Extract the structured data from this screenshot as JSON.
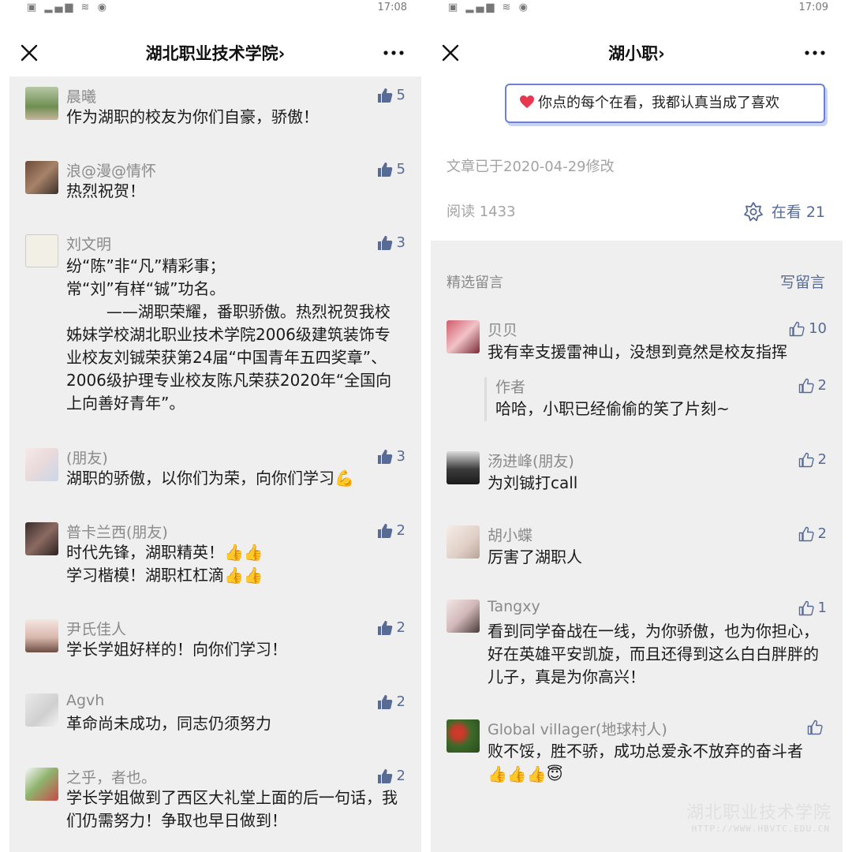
{
  "status_bar": {
    "left": {
      "time": "17:08",
      "icons": "▣ ▂▄▆ ≋ ◉"
    },
    "right": {
      "time": "17:09",
      "icons": "▣ ▂▄▆ ≋ ◉"
    }
  },
  "left": {
    "nav": {
      "title": "湖北职业技术学院",
      "chevron": "›"
    },
    "comments": [
      {
        "name": "晨曦",
        "likes": "5",
        "text": "作为湖职的校友为你们自豪，骄傲！"
      },
      {
        "name": "浪@漫@情怀",
        "likes": "5",
        "text": "热烈祝贺！"
      },
      {
        "name": "刘文明",
        "likes": "3",
        "text": "纷“陈”非“凡”精彩事；\n常“刘”有样“铖”功名。\n        ——湖职荣耀，番职骄傲。热烈祝贺我校姊妹学校湖北职业技术学院2006级建筑装饰专业校友刘铖荣获第24届“中国青年五四奖章”、2006级护理专业校友陈凡荣获2020年“全国向上向善好青年”。"
      },
      {
        "name": "(朋友)",
        "likes": "3",
        "text": "湖职的骄傲，以你们为荣，向你们学习💪"
      },
      {
        "name": "普卡兰西(朋友)",
        "likes": "2",
        "text": "时代先锋，湖职精英！👍👍\n学习楷模！湖职杠杠滴👍👍"
      },
      {
        "name": "尹氏佳人",
        "likes": "2",
        "text": "学长学姐好样的！向你们学习！"
      },
      {
        "name": "Agvh",
        "likes": "2",
        "text": "革命尚未成功，同志仍须努力"
      },
      {
        "name": "之乎，者也。",
        "likes": "2",
        "text": "学长学姐做到了西区大礼堂上面的后一句话，我们仍需努力！争取也早日做到！"
      }
    ]
  },
  "right": {
    "nav": {
      "title": "湖小职",
      "chevron": "›"
    },
    "popup_text": "你点的每个在看，我都认真当成了喜欢",
    "modified": "文章已于2020-04-29修改",
    "reads": "阅读 1433",
    "zaikan": "在看 21",
    "section": {
      "title": "精选留言",
      "write": "写留言"
    },
    "comments": [
      {
        "name": "贝贝",
        "likes": "10",
        "text": "我有幸支援雷神山，没想到竟然是校友指挥"
      },
      {
        "name": "作者",
        "likes": "2",
        "text": "哈哈，小职已经偷偷的笑了片刻~"
      },
      {
        "name": "汤进峰(朋友)",
        "likes": "2",
        "text": "为刘铖打call"
      },
      {
        "name": "胡小蝶",
        "likes": "2",
        "text": "厉害了湖职人"
      },
      {
        "name": "Tangxy",
        "likes": "1",
        "text": "看到同学奋战在一线，为你骄傲，也为你担心，好在英雄平安凯旋，而且还得到这么白白胖胖的儿子，真是为你高兴！"
      },
      {
        "name": "Global villager(地球村人)",
        "likes": "",
        "text": "败不馁，胜不骄，成功总爱永不放弃的奋斗者👍👍👍😇"
      }
    ],
    "watermark": {
      "title": "湖北职业技术学院",
      "url": "HTTP://WWW.HBVTC.EDU.CN"
    }
  },
  "colors": {
    "accent": "#576b95",
    "comment_bg": "#efefef",
    "popup_border": "#6b80d6",
    "heart": "#e8384f"
  },
  "icons": [
    "close-icon",
    "more-icon",
    "thumbs-up-icon",
    "thumbs-up-outline-icon",
    "heart-icon",
    "zaikan-icon"
  ]
}
